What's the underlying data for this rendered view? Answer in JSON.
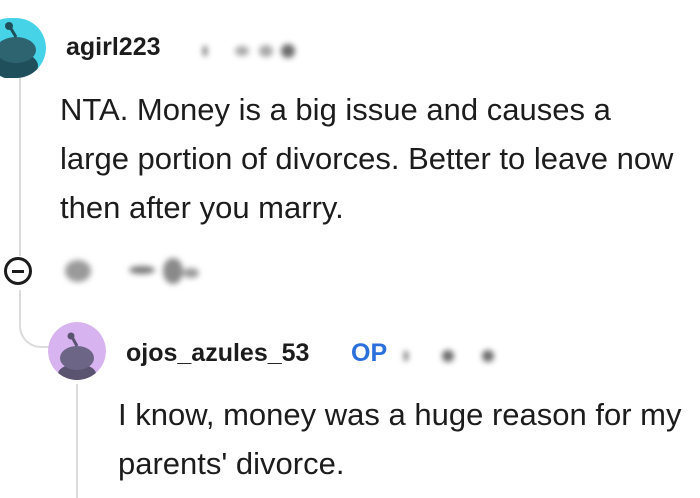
{
  "comments": [
    {
      "username": "agirl223",
      "body": "NTA. Money is a big issue and causes a large portion of divorces. Better to leave now then after you marry.",
      "avatar_color": "#46d3e8",
      "avatar_icon": "reddit-snoo-icon"
    },
    {
      "username": "ojos_azules_53",
      "op_badge": "OP",
      "body": "I know, money was a huge reason for my parents' divorce.",
      "avatar_color": "#d7b4f0",
      "avatar_icon": "reddit-snoo-icon"
    }
  ],
  "actions": {
    "collapse_icon": "collapse-minus-icon"
  },
  "colors": {
    "op_badge": "#2a6fdb",
    "thread_line": "#dcdcdc"
  }
}
